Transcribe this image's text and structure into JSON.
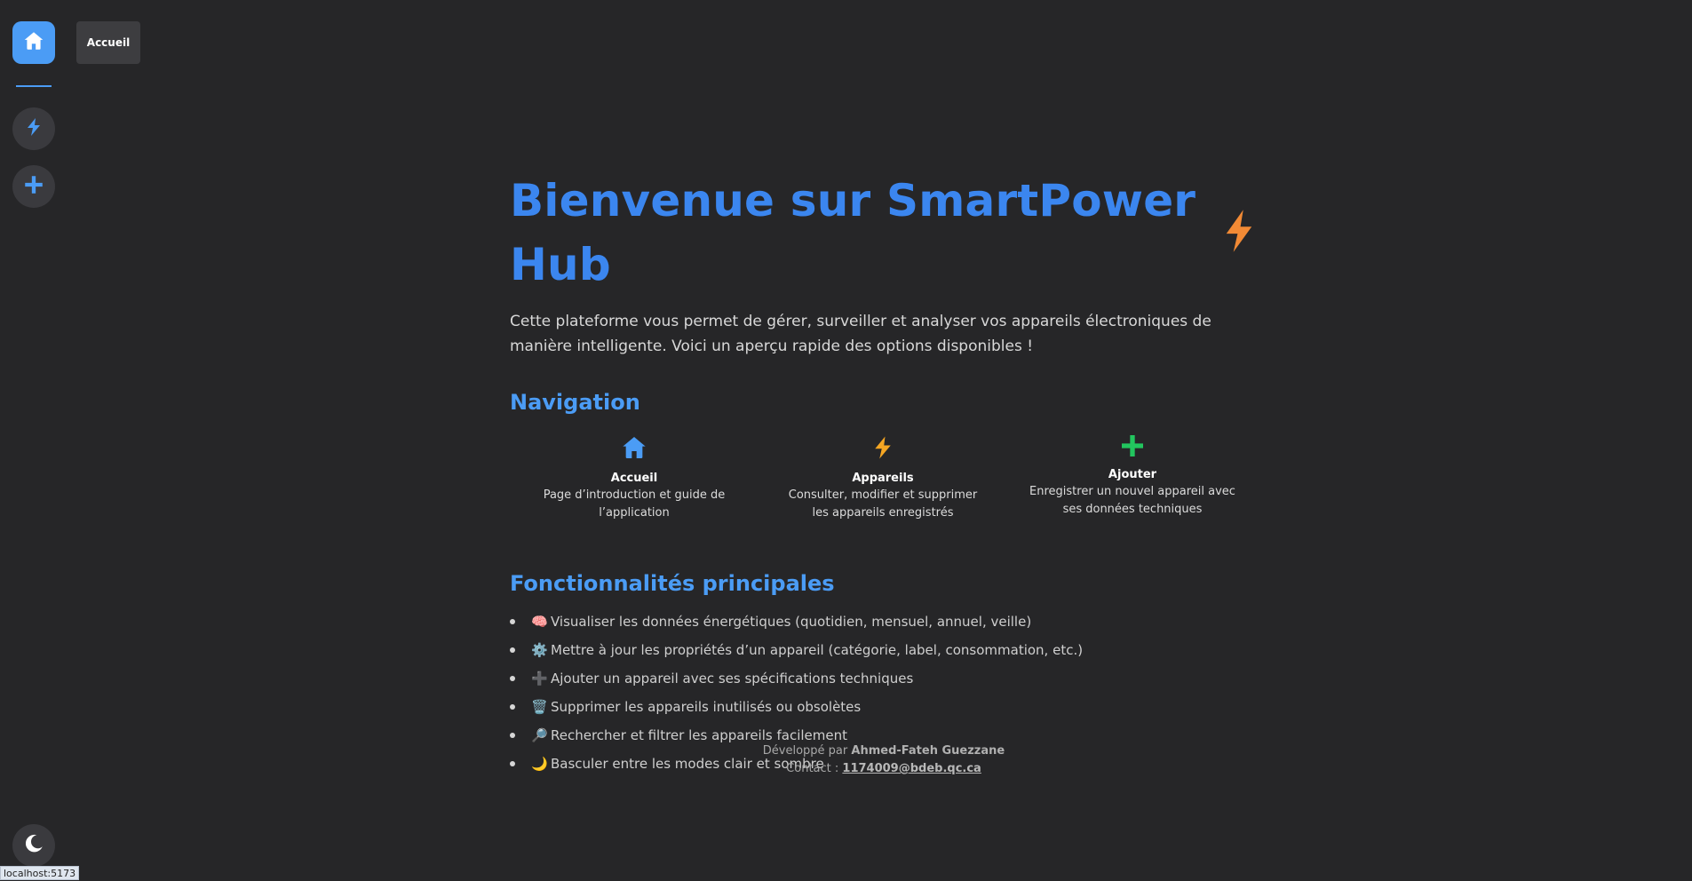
{
  "sidebar": {
    "tooltip": "Accueil",
    "items": [
      {
        "name": "home",
        "icon": "home-icon"
      },
      {
        "name": "devices",
        "icon": "bolt-icon"
      },
      {
        "name": "add",
        "icon": "plus-icon"
      }
    ],
    "theme_toggle_icon": "moon-icon"
  },
  "status_bar_url": "localhost:5173",
  "main": {
    "title": "Bienvenue sur SmartPower Hub",
    "title_icon": "bolt-icon",
    "intro": "Cette plateforme vous permet de gérer, surveiller et analyser vos appareils électroniques de manière intelligente. Voici un aperçu rapide des options disponibles !",
    "navigation_title": "Navigation",
    "navigation": [
      {
        "icon": "home-icon",
        "label": "Accueil",
        "description": "Page d’introduction et guide de l’application"
      },
      {
        "icon": "bolt-icon",
        "label": "Appareils",
        "description": "Consulter, modifier et supprimer les appareils enregistrés"
      },
      {
        "icon": "plus-icon",
        "label": "Ajouter",
        "description": "Enregistrer un nouvel appareil avec ses données techniques"
      }
    ],
    "features_title": "Fonctionnalités principales",
    "features": [
      {
        "emoji": "🧠",
        "text": "Visualiser les données énergétiques (quotidien, mensuel, annuel, veille)"
      },
      {
        "emoji": "⚙️",
        "text": "Mettre à jour les propriétés d’un appareil (catégorie, label, consommation, etc.)"
      },
      {
        "emoji": "➕",
        "text": "Ajouter un appareil avec ses spécifications techniques"
      },
      {
        "emoji": "🗑️",
        "text": "Supprimer les appareils inutilisés ou obsolètes"
      },
      {
        "emoji": "🔎",
        "text": "Rechercher et filtrer les appareils facilement"
      },
      {
        "emoji": "🌙",
        "text": "Basculer entre les modes clair et sombre"
      }
    ]
  },
  "footer": {
    "developed_by_prefix": "Développé par",
    "author": "Ahmed-Fateh Guezzane",
    "contact_prefix": "Contact :",
    "email": "1174009@bdeb.qc.ca"
  },
  "colors": {
    "accent": "#4b9cf5",
    "title": "#3b86ef",
    "bolt_orange": "#f28a35",
    "bolt_yellow": "#f5a623",
    "plus_green": "#22c55e",
    "background": "#262628"
  }
}
